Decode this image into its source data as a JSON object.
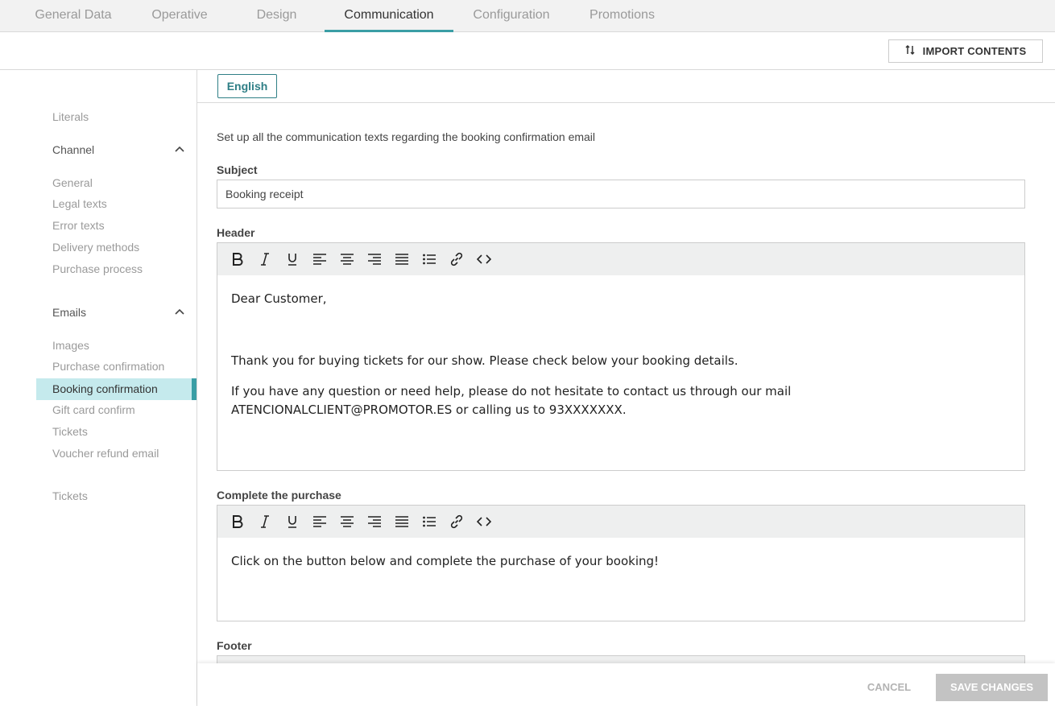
{
  "tabs": [
    {
      "label": "General Data"
    },
    {
      "label": "Operative"
    },
    {
      "label": "Design"
    },
    {
      "label": "Communication"
    },
    {
      "label": "Configuration"
    },
    {
      "label": "Promotions"
    }
  ],
  "actions": {
    "import_label": "IMPORT CONTENTS",
    "import_icon": "sort-arrows-icon"
  },
  "sidebar": {
    "literals": "Literals",
    "channel": "Channel",
    "channel_items": [
      "General",
      "Legal texts",
      "Error texts",
      "Delivery methods",
      "Purchase process"
    ],
    "emails": "Emails",
    "emails_items": [
      "Images",
      "Purchase confirmation",
      "Booking confirmation",
      "Gift card confirm",
      "Tickets",
      "Voucher refund email"
    ],
    "tickets": "Tickets"
  },
  "language": {
    "label": "English"
  },
  "intro": "Set up all the communication texts regarding the booking confirmation email",
  "subject": {
    "label": "Subject",
    "value": "Booking receipt"
  },
  "header": {
    "label": "Header",
    "p1": "Dear Customer,",
    "p2": "Thank you for buying tickets for our show. Please check below your booking details.",
    "p3": "If you have any question or need help, please do not hesitate to contact us through our mail ATENCIONALCLIENT@PROMOTOR.ES or calling us to 93XXXXXXX."
  },
  "complete": {
    "label": "Complete the purchase",
    "p1": "Click on the button below and complete the purchase of your booking!"
  },
  "footer": {
    "label": "Footer"
  },
  "buttons": {
    "cancel": "CANCEL",
    "save": "SAVE CHANGES"
  },
  "colors": {
    "accent": "#3a9ea5",
    "active_bg": "#c5eaed",
    "save_disabled": "#c3c3c3"
  }
}
